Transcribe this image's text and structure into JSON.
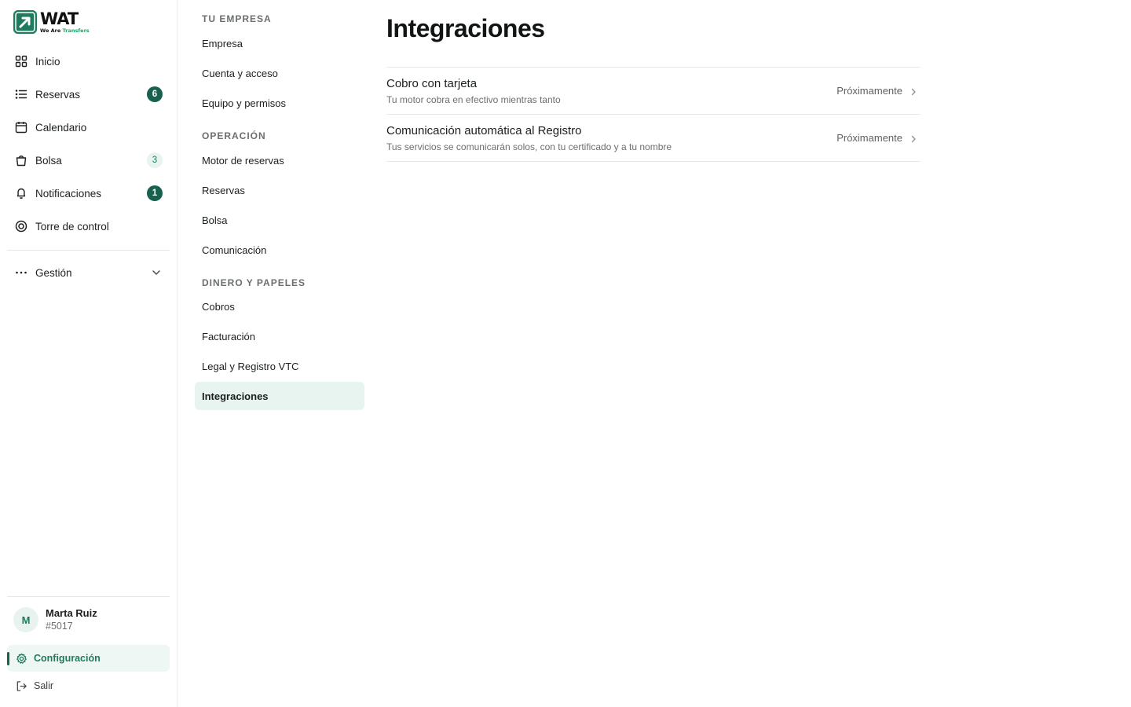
{
  "brand": {
    "name": "WAT",
    "tagline_1": "We Are",
    "tagline_2": "Transfers",
    "accent": "#17614e"
  },
  "sidebar": {
    "items": [
      {
        "label": "Inicio",
        "icon": "grid-icon"
      },
      {
        "label": "Reservas",
        "icon": "list-icon",
        "badge": "6"
      },
      {
        "label": "Calendario",
        "icon": "calendar-icon"
      },
      {
        "label": "Bolsa",
        "icon": "bag-icon",
        "badge": "3"
      },
      {
        "label": "Notificaciones",
        "icon": "bell-icon",
        "badge": "1"
      },
      {
        "label": "Torre de control",
        "icon": "target-icon"
      }
    ],
    "gestion": {
      "label": "Gestión",
      "icon": "more-dots-icon"
    },
    "user": {
      "initial": "M",
      "name": "Marta Ruiz",
      "id": "#5017"
    },
    "config_label": "Configuración",
    "logout_label": "Salir"
  },
  "settings_nav": {
    "sections": [
      {
        "title": "TU EMPRESA",
        "items": [
          "Empresa",
          "Cuenta y acceso",
          "Equipo y permisos"
        ]
      },
      {
        "title": "OPERACIÓN",
        "items": [
          "Motor de reservas",
          "Reservas",
          "Bolsa",
          "Comunicación"
        ]
      },
      {
        "title": "DINERO Y PAPELES",
        "items": [
          "Cobros",
          "Facturación",
          "Legal y Registro VTC",
          "Integraciones"
        ]
      }
    ],
    "active": "Integraciones"
  },
  "main": {
    "title": "Integraciones",
    "integrations": [
      {
        "title": "Cobro con tarjeta",
        "description": "Tu motor cobra en efectivo mientras tanto",
        "status": "Próximamente"
      },
      {
        "title": "Comunicación automática al Registro",
        "description": "Tus servicios se comunicarán solos, con tu certificado y a tu nombre",
        "status": "Próximamente"
      }
    ]
  }
}
